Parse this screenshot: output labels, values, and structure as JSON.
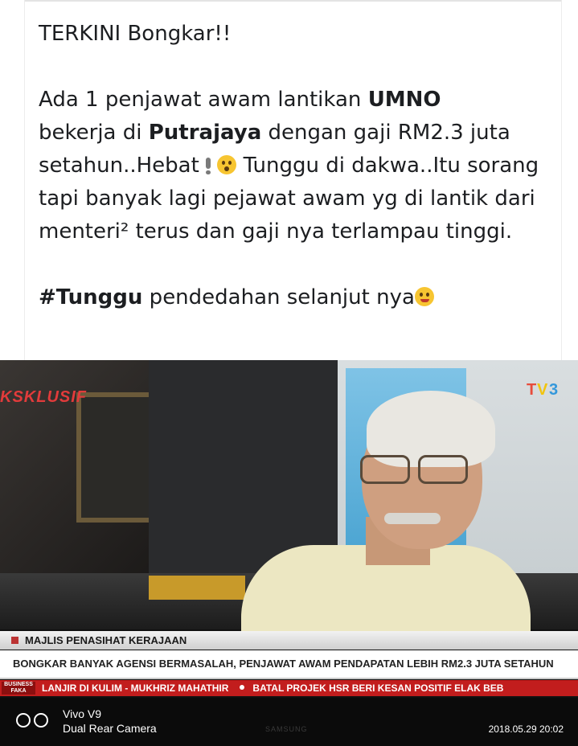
{
  "post": {
    "title": "TERKINI Bongkar!!",
    "para1_pre": "Ada 1 penjawat awam lantikan ",
    "para1_bold1": "UMNO",
    "para1_mid": " bekerja di ",
    "para1_bold2": "Putrajaya",
    "para1_post": " dengan gaji RM2.3 juta setahun..Hebat",
    "para1_tail": " Tunggu di dakwa..Itu sorang tapi banyak lagi pejawat awam yg di lantik dari menteri² terus dan gaji nya terlampau tinggi.",
    "hashtag": "#Tunggu",
    "para2": " pendedahan selanjut nya"
  },
  "tv": {
    "segment": "KSKLUSIF",
    "channel_logo": "TV3",
    "lower_third_label": "MAJLIS PENASIHAT KERAJAAN",
    "headline": "BONGKAR BANYAK AGENSI BERMASALAH, PENJAWAT AWAM PENDAPATAN LEBIH RM2.3 JUTA SETAHUN",
    "ticker_box": "BUSINESS FAKA",
    "ticker_items": [
      "LANJIR DI KULIM - MUKHRIZ MAHATHIR",
      "BATAL PROJEK HSR BERI KESAN POSITIF ELAK BEB"
    ],
    "tv_brand": "SAMSUNG"
  },
  "watermark": {
    "device": "Vivo V9",
    "camera": "Dual Rear Camera",
    "timestamp": "2018.05.29 20:02"
  },
  "icons": {
    "emoji1": "hushed-face-icon",
    "emoji2": "winking-face-icon",
    "exclamation": "exclamation-icon",
    "camera": "dual-camera-icon"
  },
  "colors": {
    "text": "#1c1e21",
    "ticker_red": "#c21d1d",
    "emoji_yellow": "#f7c531"
  }
}
